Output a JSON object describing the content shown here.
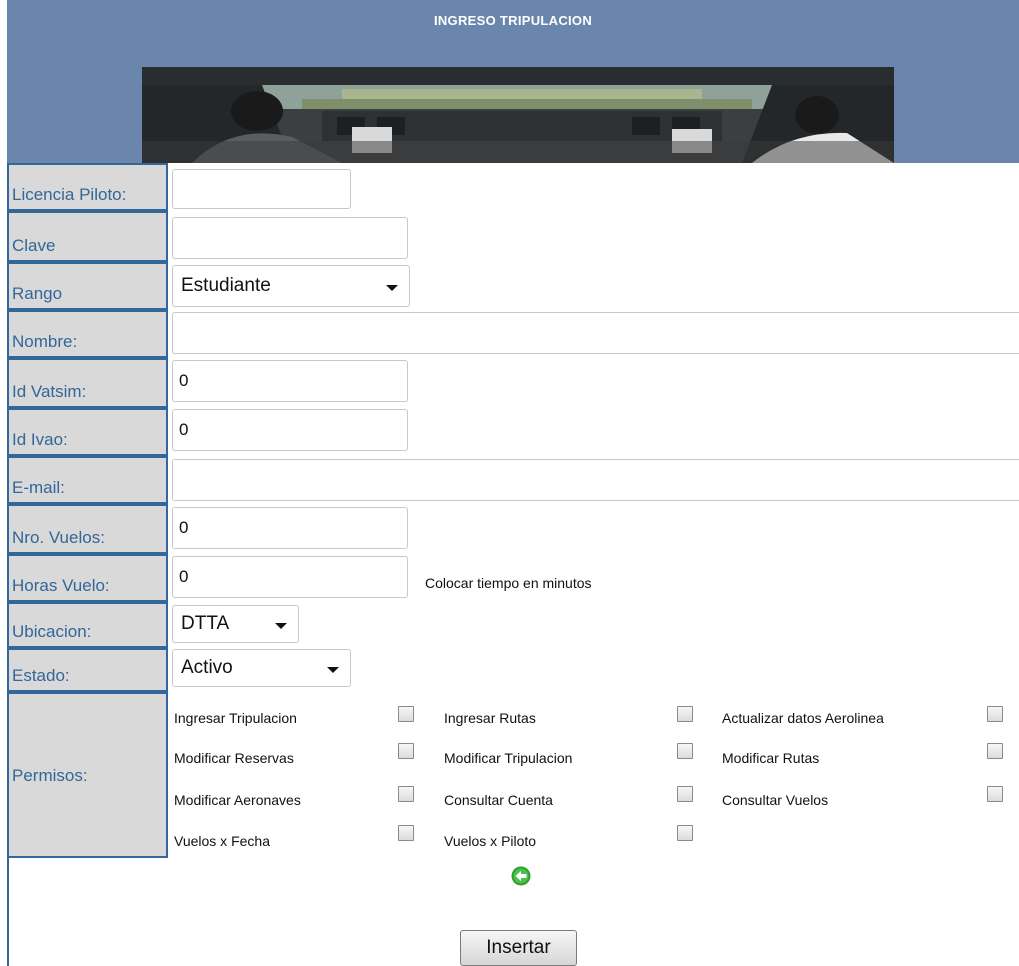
{
  "header": {
    "title": "INGRESO TRIPULACION"
  },
  "fields": {
    "licencia": {
      "label": "Licencia Piloto:",
      "value": ""
    },
    "clave": {
      "label": "Clave",
      "value": ""
    },
    "rango": {
      "label": "Rango",
      "value": "Estudiante"
    },
    "nombre": {
      "label": "Nombre:",
      "value": ""
    },
    "vatsim": {
      "label": "Id Vatsim:",
      "value": "0"
    },
    "ivao": {
      "label": "Id Ivao:",
      "value": "0"
    },
    "email": {
      "label": "E-mail:",
      "value": ""
    },
    "vuelos": {
      "label": "Nro. Vuelos:",
      "value": "0"
    },
    "horas": {
      "label": "Horas Vuelo:",
      "value": "0",
      "hint": "Colocar tiempo en minutos"
    },
    "ubicacion": {
      "label": "Ubicacion:",
      "value": "DTTA"
    },
    "estado": {
      "label": "Estado:",
      "value": "Activo"
    }
  },
  "permisos": {
    "label": "Permisos:",
    "items": [
      "Ingresar Tripulacion",
      "Ingresar Rutas",
      "Actualizar datos Aerolinea",
      "Modificar Reservas",
      "Modificar Tripulacion",
      "Modificar Rutas",
      "Modificar Aeronaves",
      "Consultar Cuenta",
      "Consultar Vuelos",
      "Vuelos x Fecha",
      "Vuelos x Piloto"
    ],
    "checked": [
      false,
      false,
      false,
      false,
      false,
      false,
      false,
      false,
      false,
      false,
      false
    ]
  },
  "actions": {
    "insert_label": "Insertar"
  },
  "icons": {
    "back": "back-arrow-icon",
    "back_color": "#2e9e2e"
  },
  "colors": {
    "header_bg": "#6a86ad",
    "label_text": "#336699",
    "label_bg": "#d9d9d9"
  }
}
